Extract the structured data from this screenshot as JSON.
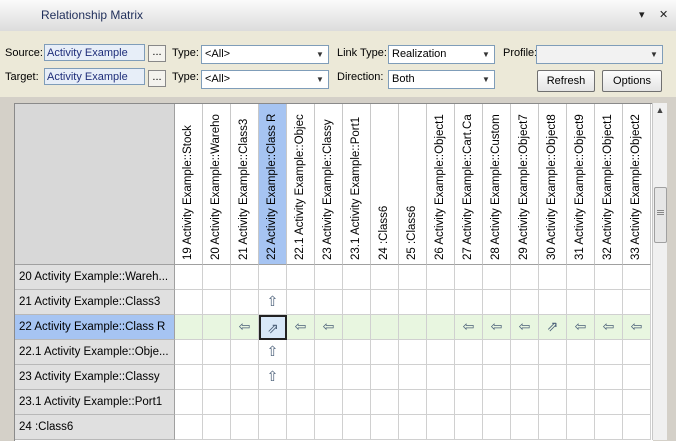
{
  "window": {
    "title": "Relationship Matrix",
    "pin_glyph": "▾",
    "close_glyph": "✕"
  },
  "toolbar": {
    "source_label": "Source:",
    "source_value": "Activity Example",
    "target_label": "Target:",
    "target_value": "Activity Example",
    "browse_label": "...",
    "type_label": "Type:",
    "source_type": "<All>",
    "target_type": "<All>",
    "link_type_label": "Link Type:",
    "link_type": "Realization",
    "direction_label": "Direction:",
    "direction": "Both",
    "profile_label": "Profile:",
    "profile": "",
    "refresh_label": "Refresh",
    "options_label": "Options"
  },
  "matrix": {
    "columns": [
      "19 Activity Example::Stock",
      "20 Activity Example::Wareho",
      "21 Activity Example::Class3",
      "22 Activity Example::Class R",
      "22.1 Activity Example::Objec",
      "23 Activity Example::Classy",
      "23.1 Activity Example::Port1",
      "24 :Class6",
      "25 :Class6",
      "26 Activity Example::Object1",
      "27 Activity Example::Cart.Ca",
      "28 Activity Example::Custom",
      "29 Activity Example::Object7",
      "30 Activity Example::Object8",
      "31 Activity Example::Object9",
      "32 Activity Example::Object1",
      "33 Activity Example::Object2"
    ],
    "selected_column": 3,
    "rows": [
      {
        "label": "20 Activity Example::Wareh...",
        "selected": false,
        "cells": [
          "",
          "",
          "",
          "",
          "",
          "",
          "",
          "",
          "",
          "",
          "",
          "",
          "",
          "",
          "",
          "",
          ""
        ]
      },
      {
        "label": "21 Activity Example::Class3",
        "selected": false,
        "cells": [
          "",
          "",
          "",
          "up",
          "",
          "",
          "",
          "",
          "",
          "",
          "",
          "",
          "",
          "",
          "",
          "",
          ""
        ]
      },
      {
        "label": "22 Activity Example::Class R",
        "selected": true,
        "cells": [
          "",
          "",
          "left",
          "both",
          "left",
          "left",
          "",
          "",
          "",
          "",
          "left",
          "left",
          "left",
          "both",
          "left",
          "left",
          "left"
        ]
      },
      {
        "label": "22.1 Activity Example::Obje...",
        "selected": false,
        "cells": [
          "",
          "",
          "",
          "up",
          "",
          "",
          "",
          "",
          "",
          "",
          "",
          "",
          "",
          "",
          "",
          "",
          ""
        ]
      },
      {
        "label": "23 Activity Example::Classy",
        "selected": false,
        "cells": [
          "",
          "",
          "",
          "up",
          "",
          "",
          "",
          "",
          "",
          "",
          "",
          "",
          "",
          "",
          "",
          "",
          ""
        ]
      },
      {
        "label": "23.1 Activity Example::Port1",
        "selected": false,
        "cells": [
          "",
          "",
          "",
          "",
          "",
          "",
          "",
          "",
          "",
          "",
          "",
          "",
          "",
          "",
          "",
          "",
          ""
        ]
      },
      {
        "label": "24 :Class6",
        "selected": false,
        "cells": [
          "",
          "",
          "",
          "",
          "",
          "",
          "",
          "",
          "",
          "",
          "",
          "",
          "",
          "",
          "",
          "",
          ""
        ]
      }
    ],
    "arrow_glyphs": {
      "up": "⇧",
      "left": "⇦",
      "both": "⇗"
    },
    "colors": {
      "selection": "#a6c4f2",
      "highlight_row": "#e8f6e0",
      "arrow": "#4a5f78"
    }
  }
}
